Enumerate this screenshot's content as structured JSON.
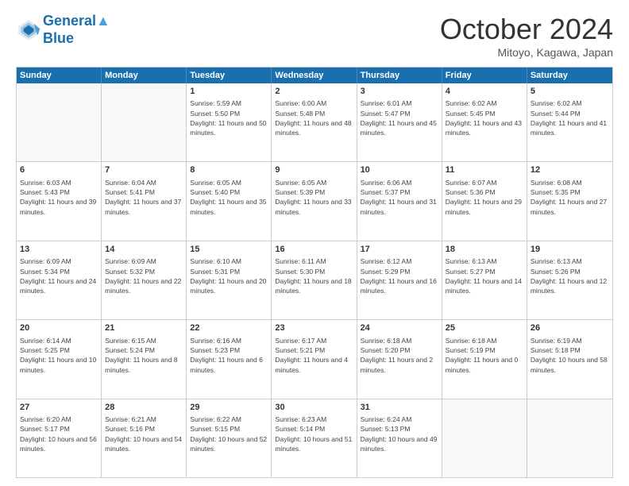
{
  "header": {
    "logo_line1": "General",
    "logo_line2": "Blue",
    "month": "October 2024",
    "location": "Mitoyo, Kagawa, Japan"
  },
  "weekdays": [
    "Sunday",
    "Monday",
    "Tuesday",
    "Wednesday",
    "Thursday",
    "Friday",
    "Saturday"
  ],
  "rows": [
    [
      {
        "day": "",
        "sunrise": "",
        "sunset": "",
        "daylight": ""
      },
      {
        "day": "",
        "sunrise": "",
        "sunset": "",
        "daylight": ""
      },
      {
        "day": "1",
        "sunrise": "Sunrise: 5:59 AM",
        "sunset": "Sunset: 5:50 PM",
        "daylight": "Daylight: 11 hours and 50 minutes."
      },
      {
        "day": "2",
        "sunrise": "Sunrise: 6:00 AM",
        "sunset": "Sunset: 5:48 PM",
        "daylight": "Daylight: 11 hours and 48 minutes."
      },
      {
        "day": "3",
        "sunrise": "Sunrise: 6:01 AM",
        "sunset": "Sunset: 5:47 PM",
        "daylight": "Daylight: 11 hours and 45 minutes."
      },
      {
        "day": "4",
        "sunrise": "Sunrise: 6:02 AM",
        "sunset": "Sunset: 5:45 PM",
        "daylight": "Daylight: 11 hours and 43 minutes."
      },
      {
        "day": "5",
        "sunrise": "Sunrise: 6:02 AM",
        "sunset": "Sunset: 5:44 PM",
        "daylight": "Daylight: 11 hours and 41 minutes."
      }
    ],
    [
      {
        "day": "6",
        "sunrise": "Sunrise: 6:03 AM",
        "sunset": "Sunset: 5:43 PM",
        "daylight": "Daylight: 11 hours and 39 minutes."
      },
      {
        "day": "7",
        "sunrise": "Sunrise: 6:04 AM",
        "sunset": "Sunset: 5:41 PM",
        "daylight": "Daylight: 11 hours and 37 minutes."
      },
      {
        "day": "8",
        "sunrise": "Sunrise: 6:05 AM",
        "sunset": "Sunset: 5:40 PM",
        "daylight": "Daylight: 11 hours and 35 minutes."
      },
      {
        "day": "9",
        "sunrise": "Sunrise: 6:05 AM",
        "sunset": "Sunset: 5:39 PM",
        "daylight": "Daylight: 11 hours and 33 minutes."
      },
      {
        "day": "10",
        "sunrise": "Sunrise: 6:06 AM",
        "sunset": "Sunset: 5:37 PM",
        "daylight": "Daylight: 11 hours and 31 minutes."
      },
      {
        "day": "11",
        "sunrise": "Sunrise: 6:07 AM",
        "sunset": "Sunset: 5:36 PM",
        "daylight": "Daylight: 11 hours and 29 minutes."
      },
      {
        "day": "12",
        "sunrise": "Sunrise: 6:08 AM",
        "sunset": "Sunset: 5:35 PM",
        "daylight": "Daylight: 11 hours and 27 minutes."
      }
    ],
    [
      {
        "day": "13",
        "sunrise": "Sunrise: 6:09 AM",
        "sunset": "Sunset: 5:34 PM",
        "daylight": "Daylight: 11 hours and 24 minutes."
      },
      {
        "day": "14",
        "sunrise": "Sunrise: 6:09 AM",
        "sunset": "Sunset: 5:32 PM",
        "daylight": "Daylight: 11 hours and 22 minutes."
      },
      {
        "day": "15",
        "sunrise": "Sunrise: 6:10 AM",
        "sunset": "Sunset: 5:31 PM",
        "daylight": "Daylight: 11 hours and 20 minutes."
      },
      {
        "day": "16",
        "sunrise": "Sunrise: 6:11 AM",
        "sunset": "Sunset: 5:30 PM",
        "daylight": "Daylight: 11 hours and 18 minutes."
      },
      {
        "day": "17",
        "sunrise": "Sunrise: 6:12 AM",
        "sunset": "Sunset: 5:29 PM",
        "daylight": "Daylight: 11 hours and 16 minutes."
      },
      {
        "day": "18",
        "sunrise": "Sunrise: 6:13 AM",
        "sunset": "Sunset: 5:27 PM",
        "daylight": "Daylight: 11 hours and 14 minutes."
      },
      {
        "day": "19",
        "sunrise": "Sunrise: 6:13 AM",
        "sunset": "Sunset: 5:26 PM",
        "daylight": "Daylight: 11 hours and 12 minutes."
      }
    ],
    [
      {
        "day": "20",
        "sunrise": "Sunrise: 6:14 AM",
        "sunset": "Sunset: 5:25 PM",
        "daylight": "Daylight: 11 hours and 10 minutes."
      },
      {
        "day": "21",
        "sunrise": "Sunrise: 6:15 AM",
        "sunset": "Sunset: 5:24 PM",
        "daylight": "Daylight: 11 hours and 8 minutes."
      },
      {
        "day": "22",
        "sunrise": "Sunrise: 6:16 AM",
        "sunset": "Sunset: 5:23 PM",
        "daylight": "Daylight: 11 hours and 6 minutes."
      },
      {
        "day": "23",
        "sunrise": "Sunrise: 6:17 AM",
        "sunset": "Sunset: 5:21 PM",
        "daylight": "Daylight: 11 hours and 4 minutes."
      },
      {
        "day": "24",
        "sunrise": "Sunrise: 6:18 AM",
        "sunset": "Sunset: 5:20 PM",
        "daylight": "Daylight: 11 hours and 2 minutes."
      },
      {
        "day": "25",
        "sunrise": "Sunrise: 6:18 AM",
        "sunset": "Sunset: 5:19 PM",
        "daylight": "Daylight: 11 hours and 0 minutes."
      },
      {
        "day": "26",
        "sunrise": "Sunrise: 6:19 AM",
        "sunset": "Sunset: 5:18 PM",
        "daylight": "Daylight: 10 hours and 58 minutes."
      }
    ],
    [
      {
        "day": "27",
        "sunrise": "Sunrise: 6:20 AM",
        "sunset": "Sunset: 5:17 PM",
        "daylight": "Daylight: 10 hours and 56 minutes."
      },
      {
        "day": "28",
        "sunrise": "Sunrise: 6:21 AM",
        "sunset": "Sunset: 5:16 PM",
        "daylight": "Daylight: 10 hours and 54 minutes."
      },
      {
        "day": "29",
        "sunrise": "Sunrise: 6:22 AM",
        "sunset": "Sunset: 5:15 PM",
        "daylight": "Daylight: 10 hours and 52 minutes."
      },
      {
        "day": "30",
        "sunrise": "Sunrise: 6:23 AM",
        "sunset": "Sunset: 5:14 PM",
        "daylight": "Daylight: 10 hours and 51 minutes."
      },
      {
        "day": "31",
        "sunrise": "Sunrise: 6:24 AM",
        "sunset": "Sunset: 5:13 PM",
        "daylight": "Daylight: 10 hours and 49 minutes."
      },
      {
        "day": "",
        "sunrise": "",
        "sunset": "",
        "daylight": ""
      },
      {
        "day": "",
        "sunrise": "",
        "sunset": "",
        "daylight": ""
      }
    ]
  ]
}
